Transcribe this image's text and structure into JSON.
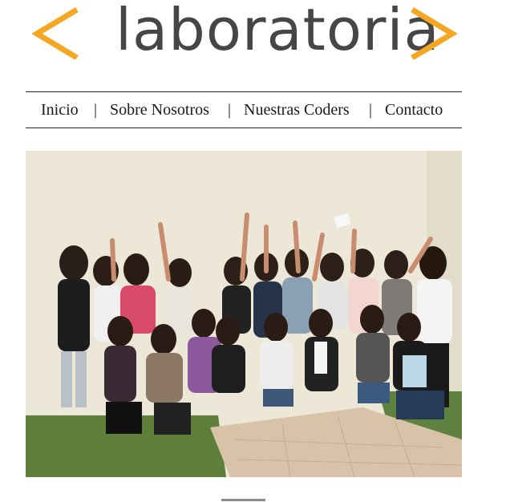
{
  "logo": {
    "text": "laboratoria",
    "accent_color": "#f5a623",
    "text_color": "#464646"
  },
  "nav": {
    "items": [
      {
        "label": "Inicio"
      },
      {
        "label": "Sobre Nosotros"
      },
      {
        "label": "Nuestras Coders"
      },
      {
        "label": "Contacto"
      }
    ],
    "separator": "|"
  },
  "hero": {
    "image": "group-photo"
  }
}
